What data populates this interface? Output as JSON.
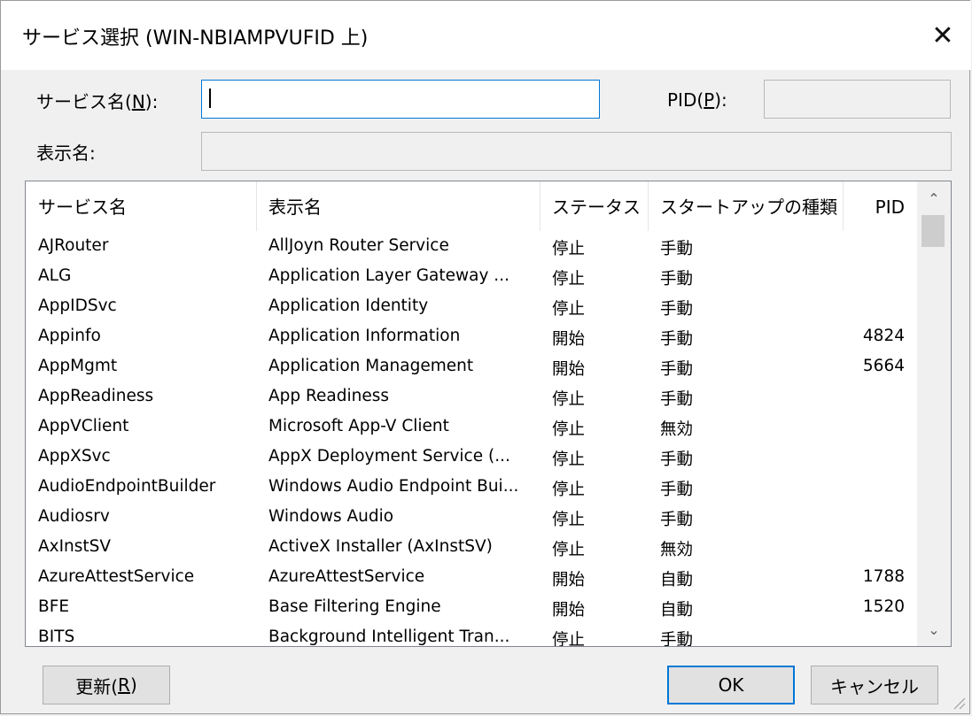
{
  "window": {
    "title": "サービス選択 (WIN-NBIAMPVUFID 上)",
    "close_glyph": "✕"
  },
  "form": {
    "service_name_label": "サービス名(",
    "service_name_key": "N",
    "service_name_label_end": "):",
    "service_name_value": "",
    "pid_label": "PID(",
    "pid_key": "P",
    "pid_label_end": "):",
    "pid_value": "",
    "display_name_label": "表示名:",
    "display_name_value": ""
  },
  "list": {
    "columns": [
      "サービス名",
      "表示名",
      "ステータス",
      "スタートアップの種類",
      "PID"
    ],
    "rows": [
      [
        "AJRouter",
        "AllJoyn Router Service",
        "停止",
        "手動",
        ""
      ],
      [
        "ALG",
        "Application Layer Gateway ...",
        "停止",
        "手動",
        ""
      ],
      [
        "AppIDSvc",
        "Application Identity",
        "停止",
        "手動",
        ""
      ],
      [
        "Appinfo",
        "Application Information",
        "開始",
        "手動",
        "4824"
      ],
      [
        "AppMgmt",
        "Application Management",
        "開始",
        "手動",
        "5664"
      ],
      [
        "AppReadiness",
        "App Readiness",
        "停止",
        "手動",
        ""
      ],
      [
        "AppVClient",
        "Microsoft App-V Client",
        "停止",
        "無効",
        ""
      ],
      [
        "AppXSvc",
        "AppX Deployment Service (...",
        "停止",
        "手動",
        ""
      ],
      [
        "AudioEndpointBuilder",
        "Windows Audio Endpoint Bui...",
        "停止",
        "手動",
        ""
      ],
      [
        "Audiosrv",
        "Windows Audio",
        "停止",
        "手動",
        ""
      ],
      [
        "AxInstSV",
        "ActiveX Installer (AxInstSV)",
        "停止",
        "無効",
        ""
      ],
      [
        "AzureAttestService",
        "AzureAttestService",
        "開始",
        "自動",
        "1788"
      ],
      [
        "BFE",
        "Base Filtering Engine",
        "開始",
        "自動",
        "1520"
      ],
      [
        "BITS",
        "Background Intelligent Tran...",
        "停止",
        "手動",
        ""
      ]
    ],
    "scroll_up_glyph": "⌃",
    "scroll_down_glyph": "⌄"
  },
  "buttons": {
    "refresh_label": "更新(",
    "refresh_key": "R",
    "refresh_label_end": ")",
    "ok_label": "OK",
    "cancel_label": "キャンセル"
  }
}
